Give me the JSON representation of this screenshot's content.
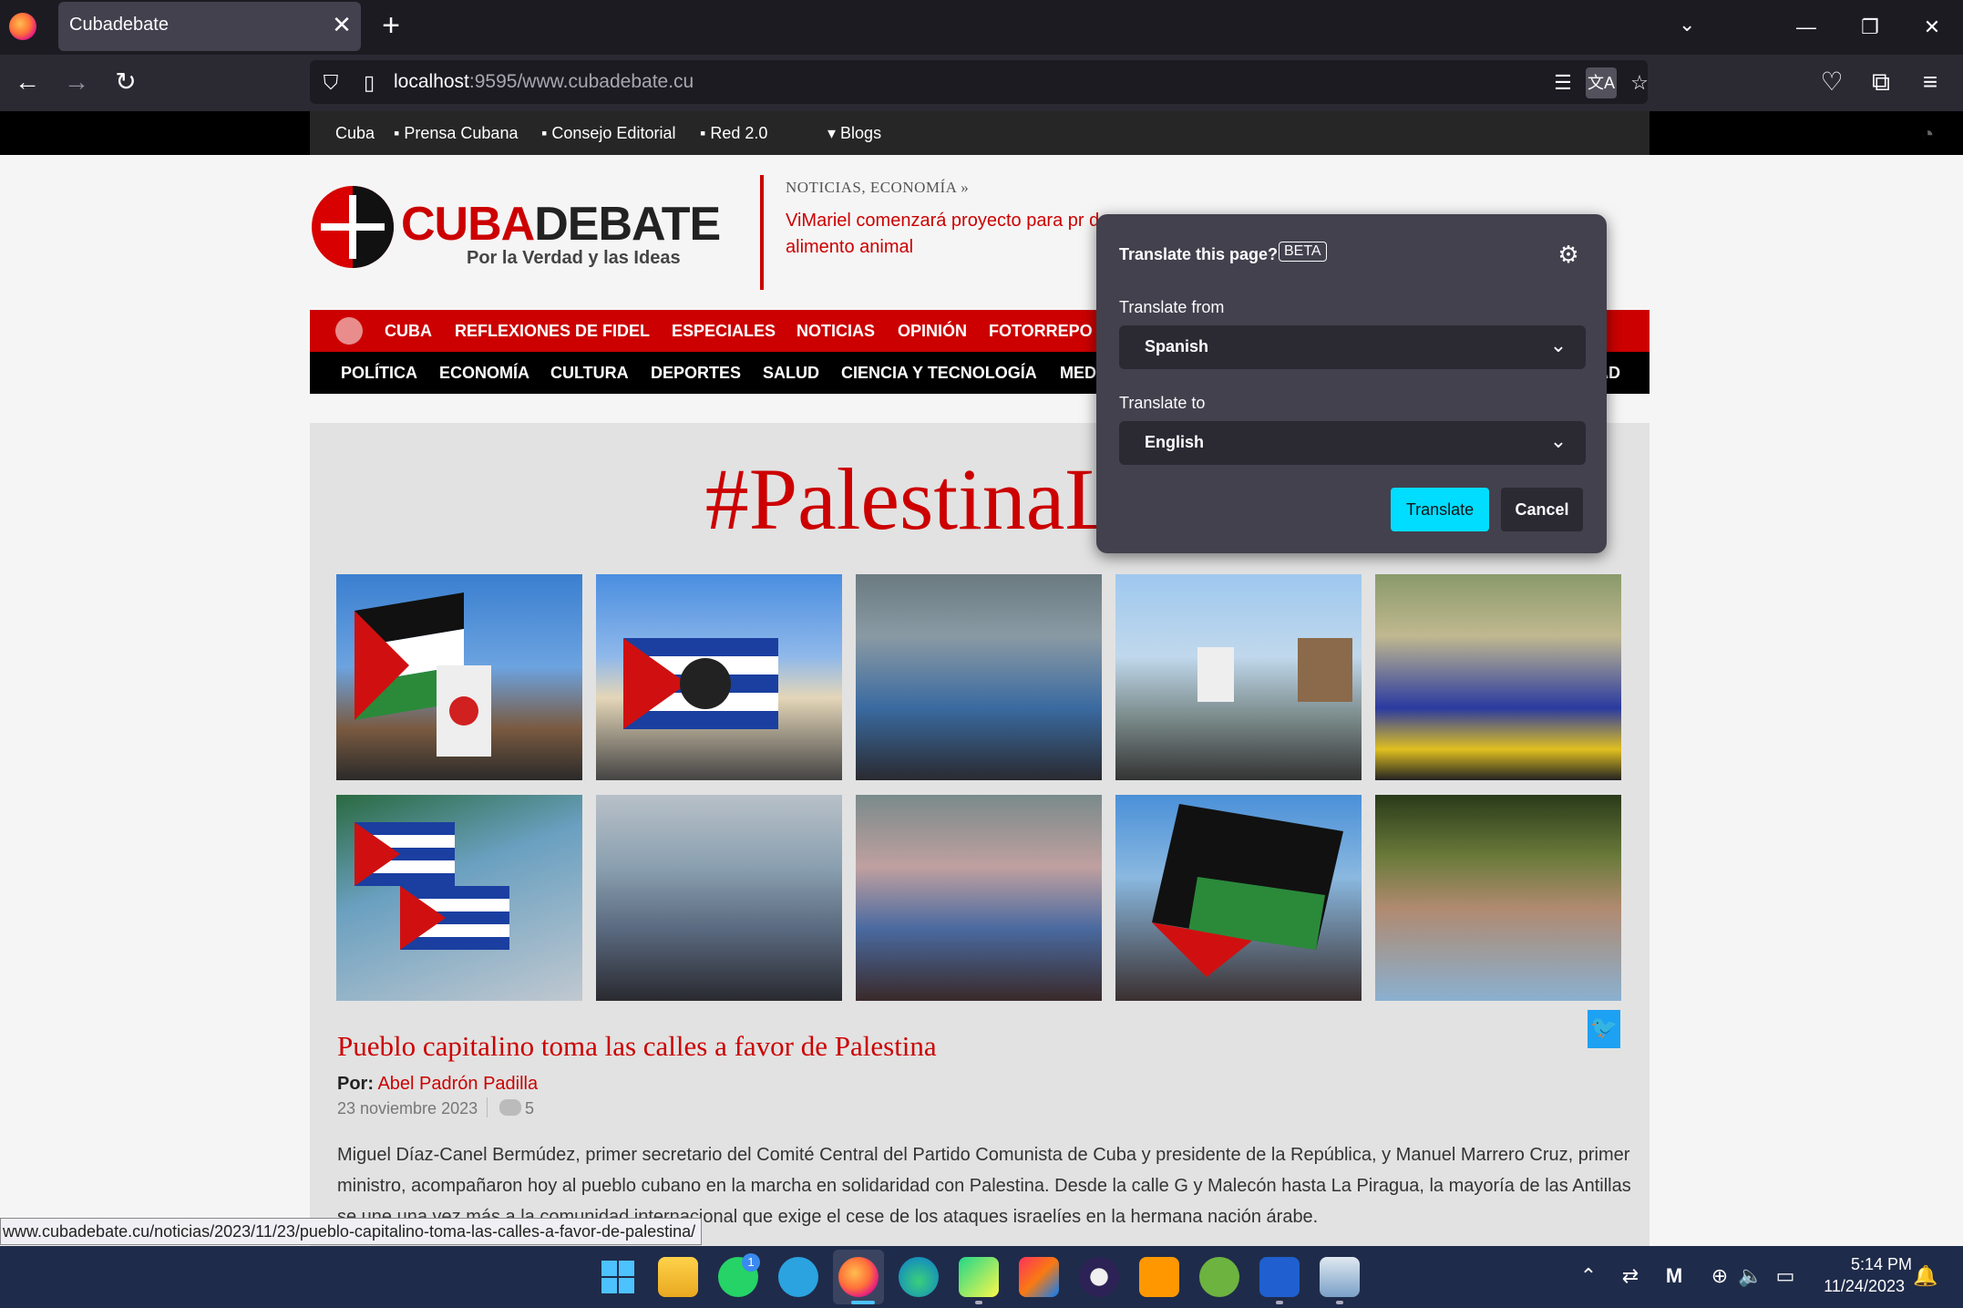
{
  "browser": {
    "tab_title": "Cubadebate",
    "url_host": "localhost",
    "url_path": ":9595/www.cubadebate.cu",
    "status_link": "www.cubadebate.cu/noticias/2023/11/23/pueblo-capitalino-toma-las-calles-a-favor-de-palestina/",
    "glyphs": {
      "close": "✕",
      "new_tab": "+",
      "list_tabs": "⌄",
      "minimize": "—",
      "restore": "❐",
      "win_close": "✕",
      "back": "←",
      "forward": "→",
      "reload": "↻",
      "shield": "⛉",
      "page": "▯",
      "reader": "☰",
      "translate": "文A",
      "star": "☆",
      "pocket": "♡",
      "extensions": "⧉",
      "menu": "≡"
    }
  },
  "topmenu": [
    "Cuba",
    "▪ Prensa Cubana",
    "▪ Consejo Editorial",
    "▪ Red 2.0",
    "▾ Blogs"
  ],
  "logo": {
    "red": "CUBA",
    "dark": "DEBATE",
    "tagline": "Por la Verdad y las Ideas"
  },
  "headline": {
    "category": "NOTICIAS, ECONOMÍA  »",
    "text": "ViMariel comenzará proyecto para pr de alimento animal"
  },
  "redmenu": [
    "CUBA",
    "REFLEXIONES DE FIDEL",
    "ESPECIALES",
    "NOTICIAS",
    "OPINIÓN",
    "FOTORREPO"
  ],
  "blackmenu": [
    "POLÍTICA",
    "ECONOMÍA",
    "CULTURA",
    "DEPORTES",
    "SALUD",
    "CIENCIA Y TECNOLOGÍA",
    "MED",
    "AD"
  ],
  "main": {
    "hashtag": "#PalestinaLibre",
    "article_title": "Pueblo capitalino toma las calles a favor de Palestina",
    "byline_label": "Por:",
    "byline_author": "Abel Padrón Padilla",
    "date": "23 noviembre 2023",
    "comment_count": "5",
    "body": "Miguel Díaz-Canel Bermúdez, primer secretario del Comité Central del Partido Comunista de Cuba y presidente de la República, y Manuel Marrero Cruz, primer ministro, acompañaron hoy al pueblo cubano en la marcha en solidaridad con Palestina. Desde la calle G y Malecón hasta La Piragua, la mayoría de las Antillas se une una vez más a la comunidad internacional que exige el cese de los ataques israelíes en la hermana nación árabe.",
    "twitter_glyph": "🐦"
  },
  "translate_popup": {
    "title": "Translate this page?",
    "beta": "BETA",
    "gear_glyph": "⚙",
    "from_label": "Translate from",
    "from_value": "Spanish",
    "to_label": "Translate to",
    "to_value": "English",
    "chevron": "⌄",
    "translate_button": "Translate",
    "cancel_button": "Cancel"
  },
  "taskbar": {
    "time": "5:14 PM",
    "date": "11/24/2023",
    "whatsapp_badge": "1",
    "tray_glyphs": {
      "chevron": "⌃",
      "settings": "⇄",
      "mi": "M",
      "globe": "⊕",
      "volume": "🔈",
      "battery": "▭",
      "bell": "🔔"
    }
  },
  "colors": {
    "brand_red": "#cc0000",
    "firefox_dark": "#1c1b22",
    "popup_bg": "#42414d",
    "translate_accent": "#00ddff",
    "taskbar": "#1f2b4a"
  }
}
